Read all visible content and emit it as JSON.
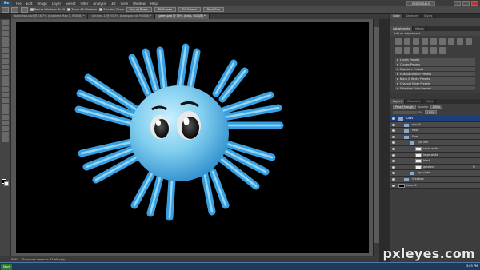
{
  "app": {
    "logo": "Ps",
    "menu": [
      "File",
      "Edit",
      "Image",
      "Layer",
      "Select",
      "Filter",
      "Analysis",
      "3D",
      "View",
      "Window",
      "Help"
    ],
    "workspace": "ESSENTIALS"
  },
  "options_bar": {
    "resize_windows": "Resize Windows To Fit",
    "zoom_all": "Zoom All Windows",
    "scrubby_zoom": "Scrubby Zoom",
    "actual_pixels": "Actual Pixels",
    "fit_screen": "Fit Screen",
    "fill_screen": "Fill Screen",
    "print_size": "Print Size"
  },
  "doc_tabs": [
    {
      "label": "backdrop.psd @ 16.7% (Gradient Map 1, RGB/8) *",
      "active": false
    },
    {
      "label": "Untitled-1 @ 33.3% (Background, RGB/8) *",
      "active": false
    },
    {
      "label": "germ.psd @ 50% (Cells, RGB/8) *",
      "active": true
    }
  ],
  "status": {
    "zoom": "50%",
    "info": "Exposure works in 32-bit only"
  },
  "panels": {
    "top_tabs": [
      "Color",
      "Swatches",
      "Styles"
    ],
    "adj_tabs": [
      "Adjustments",
      "Masks"
    ],
    "adj_title": "Add an adjustment",
    "presets": [
      "Levels Presets",
      "Curves Presets",
      "Exposure Presets",
      "Hue/Saturation Presets",
      "Black & White Presets",
      "Channel Mixer Presets",
      "Selective Color Presets"
    ],
    "layer_tabs": [
      "Layers",
      "Channels",
      "Paths"
    ],
    "blend_mode": "Pass Through",
    "opacity_label": "Opacity:",
    "opacity": "100%",
    "fill_label": "Fill:",
    "fill": "100%",
    "layers": [
      {
        "name": "Cells",
        "kind": "group",
        "indent": 0,
        "selected": true
      },
      {
        "name": "mouth",
        "kind": "group",
        "indent": 1,
        "selected": false
      },
      {
        "name": "nose",
        "kind": "group",
        "indent": 1,
        "selected": false
      },
      {
        "name": "Eyes",
        "kind": "group",
        "indent": 1,
        "selected": false
      },
      {
        "name": "Eye left",
        "kind": "group",
        "indent": 2,
        "selected": false
      },
      {
        "name": "small white",
        "kind": "layer",
        "indent": 3,
        "selected": false
      },
      {
        "name": "large white",
        "kind": "layer",
        "indent": 3,
        "selected": false
      },
      {
        "name": "black",
        "kind": "layer",
        "indent": 3,
        "selected": false
      },
      {
        "name": "gradient",
        "kind": "layer",
        "indent": 3,
        "selected": false,
        "fx": "fx"
      },
      {
        "name": "eye right",
        "kind": "group",
        "indent": 2,
        "selected": false
      },
      {
        "name": "Creature",
        "kind": "group",
        "indent": 1,
        "selected": false
      },
      {
        "name": "Layer 0",
        "kind": "black-layer",
        "indent": 0,
        "selected": false
      }
    ]
  },
  "taskbar": {
    "start": "Start",
    "clock": "3:03 PM"
  },
  "watermark": {
    "text": "pxleyes",
    "suffix": ".com"
  },
  "colors": {
    "canvas_bg": "#000000",
    "creature_light": "#8fd6f0",
    "creature_mid": "#3aa0dc",
    "selection": "#1c3f7a"
  }
}
